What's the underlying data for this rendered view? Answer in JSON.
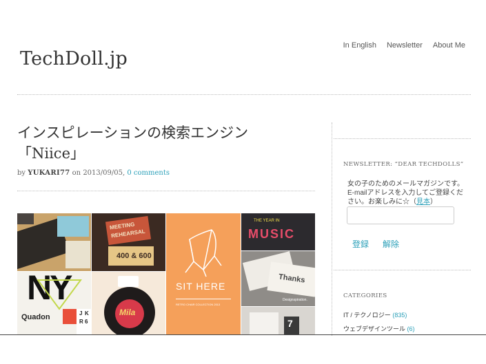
{
  "site": {
    "title": "TechDoll.jp"
  },
  "nav": {
    "items": [
      {
        "label": "In English"
      },
      {
        "label": "Newsletter"
      },
      {
        "label": "About Me"
      }
    ]
  },
  "post": {
    "title_line1": "インスピレーションの検索エンジン",
    "title_line2": "「Niice」",
    "by": "by",
    "author": "YUKARI77",
    "on": "on",
    "date": "2013/09/05,",
    "comments": "0 comments"
  },
  "thumbs": {
    "meeting": "MEETING",
    "rehearsal": "REHEARSAL",
    "nums": "400 & 600",
    "ny": "NY",
    "quadon": "Quadon",
    "mila": "Mila",
    "sit_here": "SIT HERE",
    "retro": "RETRO CHAIR COLLECTION 2013",
    "year_in": "THE YEAR IN",
    "music": "MUSIC",
    "thanks": "Thanks",
    "designspiration": "Designspiration.",
    "seven": "7",
    "letters": [
      "J",
      "K",
      "R",
      "6"
    ]
  },
  "sidebar": {
    "newsletter_title": "NEWSLETTER: “DEAR TECHDOLLS”",
    "newsletter_text": "女の子のためのメールマガジンです。E-mailアドレスを入力してご登録ください。お楽しみに☆（",
    "sample_link": "見本",
    "newsletter_text_end": "）",
    "subscribe": "登録",
    "unsubscribe": "解除",
    "categories_title": "CATEGORIES",
    "categories": [
      {
        "name": "IT / テクノロジー",
        "count": "(835)"
      },
      {
        "name": "ウェブデザインツール",
        "count": "(6)"
      }
    ]
  },
  "colors": {
    "accent": "#2a9fb8",
    "orange": "#f5a05a"
  }
}
